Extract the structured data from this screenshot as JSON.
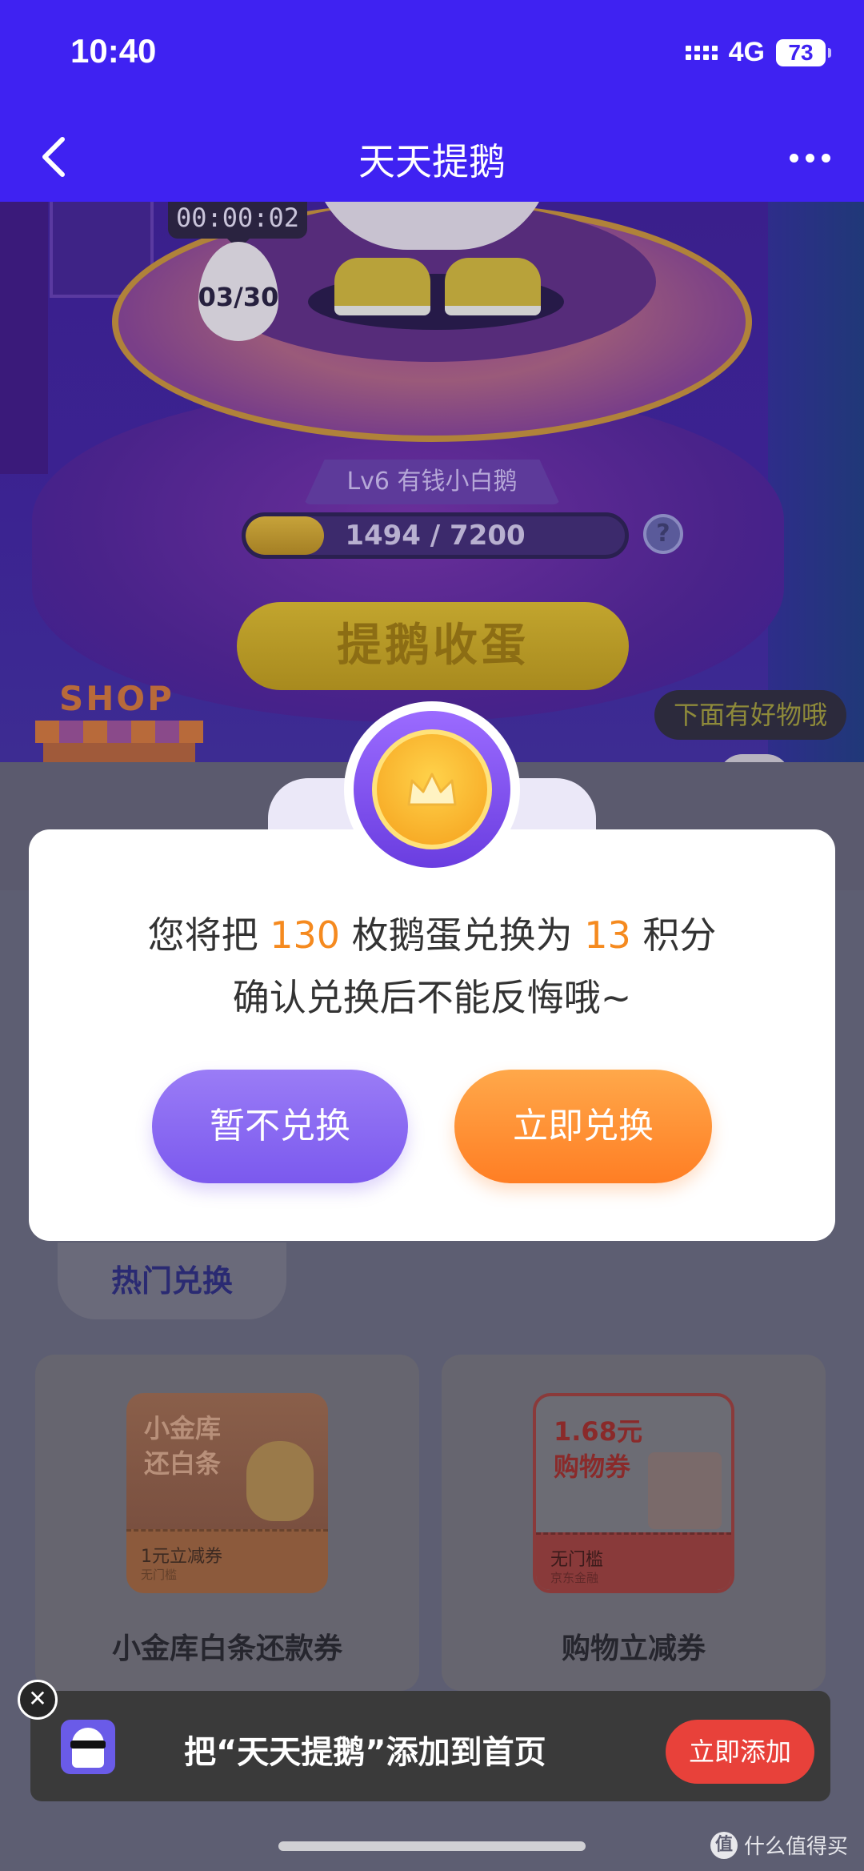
{
  "status_bar": {
    "time": "10:40",
    "network": "4G",
    "battery": "73"
  },
  "nav": {
    "title": "天天提鹅",
    "back_icon": "chevron-left-icon",
    "more_icon": "more-dots-icon"
  },
  "game": {
    "timer": "00:00:02",
    "egg_count": "03/30",
    "level": "Lv6 有钱小白鹅",
    "progress_text": "1494 / 7200",
    "progress_fraction": 0.2075,
    "help": "?",
    "harvest_button": "提鹅收蛋",
    "shop_label": "SHOP",
    "hint": "下面有好物哦"
  },
  "dialog": {
    "line1_prefix": "您将把 ",
    "eggs": "130",
    "line1_middle": " 枚鹅蛋兑换为 ",
    "points": "13",
    "line1_suffix": " 积分",
    "line2": "确认兑换后不能反悔哦~",
    "cancel_label": "暂不兑换",
    "confirm_label": "立即兑换"
  },
  "exchange": {
    "tab_label": "热门兑换",
    "cards": [
      {
        "coupon_title_1": "小金库",
        "coupon_title_2": "还白条",
        "coupon_sub": "1元立减券",
        "coupon_tiny": "无门槛",
        "label": "小金库白条还款券"
      },
      {
        "coupon_title_1": "1.68元",
        "coupon_title_2": "购物券",
        "coupon_sub": "无门槛",
        "coupon_tiny": "京东金融",
        "label": "购物立减券"
      }
    ]
  },
  "add_bar": {
    "close": "✕",
    "text": "把“天天提鹅”添加到首页",
    "button": "立即添加"
  },
  "watermark": {
    "logo": "值",
    "text": "什么值得买"
  },
  "colors": {
    "brand": "#3f22f2",
    "highlight": "#f58a1f",
    "cancel": "#7b59ee",
    "confirm": "#ff7e24",
    "add_button": "#e8413a"
  }
}
